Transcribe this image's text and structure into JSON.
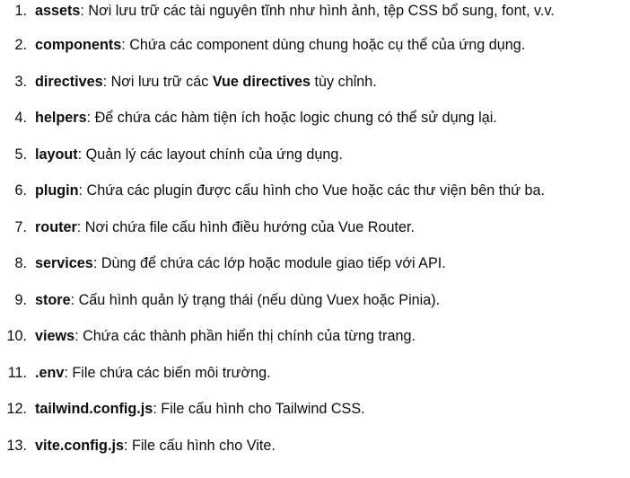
{
  "items": [
    {
      "num": "1.",
      "term": "assets",
      "desc": ": Nơi lưu trữ các tài nguyên tĩnh như hình ảnh, tệp CSS bổ sung, font, v.v."
    },
    {
      "num": "2.",
      "term": "components",
      "desc": ": Chứa các component dùng chung hoặc cụ thể của ứng dụng."
    },
    {
      "num": "3.",
      "term": "directives",
      "desc_before": ": Nơi lưu trữ các ",
      "desc_bold": "Vue directives",
      "desc_after": " tùy chỉnh."
    },
    {
      "num": "4.",
      "term": "helpers",
      "desc": ": Để chứa các hàm tiện ích hoặc logic chung có thể sử dụng lại."
    },
    {
      "num": "5.",
      "term": "layout",
      "desc": ": Quản lý các layout chính của ứng dụng."
    },
    {
      "num": "6.",
      "term": "plugin",
      "desc": ": Chứa các plugin được cấu hình cho Vue hoặc các thư viện bên thứ ba."
    },
    {
      "num": "7.",
      "term": "router",
      "desc": ": Nơi chứa file cấu hình điều hướng của Vue Router."
    },
    {
      "num": "8.",
      "term": "services",
      "desc": ": Dùng để chứa các lớp hoặc module giao tiếp với API."
    },
    {
      "num": "9.",
      "term": "store",
      "desc": ": Cấu hình quản lý trạng thái (nếu dùng Vuex hoặc Pinia)."
    },
    {
      "num": "10.",
      "term": "views",
      "desc": ": Chứa các thành phần hiển thị chính của từng trang."
    },
    {
      "num": "11.",
      "term": ".env",
      "desc": ": File chứa các biến môi trường."
    },
    {
      "num": "12.",
      "term": "tailwind.config.js",
      "desc": ": File cấu hình cho Tailwind CSS."
    },
    {
      "num": "13.",
      "term": "vite.config.js",
      "desc": ": File cấu hình cho Vite."
    }
  ]
}
